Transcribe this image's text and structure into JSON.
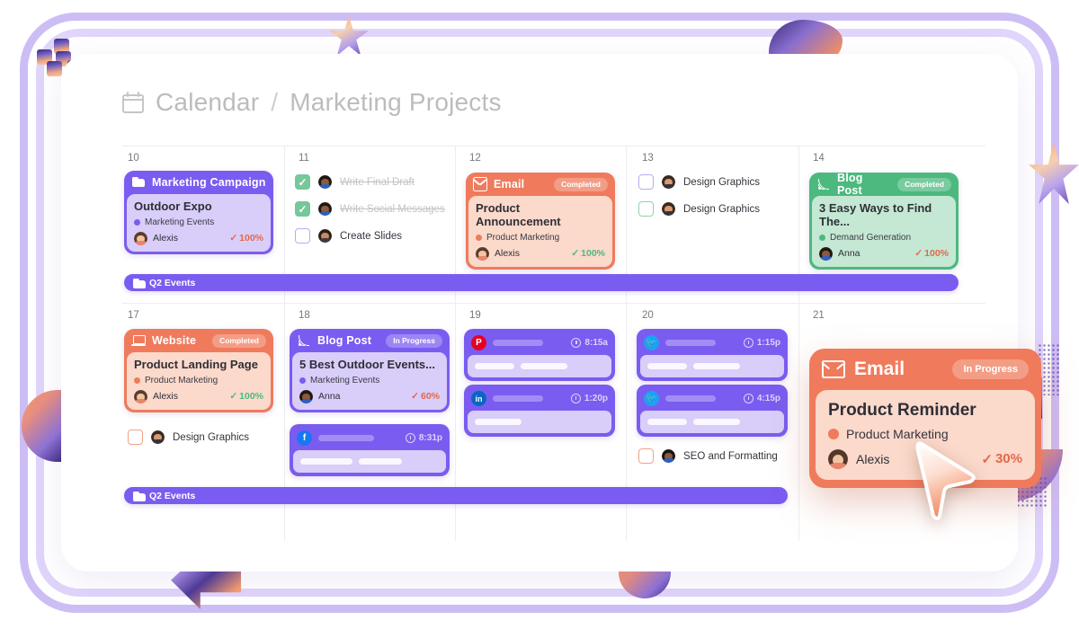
{
  "header": {
    "calendar_icon": "calendar-icon",
    "breadcrumb_root": "Calendar",
    "breadcrumb_sep": "/",
    "breadcrumb_current": "Marketing Projects"
  },
  "colors": {
    "purple": "#7b5cf0",
    "purple_light": "#d9cdf9",
    "coral": "#ef7b5c",
    "coral_light": "#fbd9cb",
    "green": "#4cb97e",
    "green_light": "#c4e8d3",
    "frame_outer": "#cdbdf5",
    "frame_inner": "#e0d5fb"
  },
  "week1": {
    "days": [
      "10",
      "11",
      "12",
      "13",
      "14"
    ],
    "cards": [
      {
        "day": "10",
        "type_label": "Marketing Campaign",
        "icon": "folder-icon",
        "badge": "",
        "title": "Outdoor Expo",
        "tag": "Marketing Events",
        "assignee": "Alexis",
        "progress": "100%",
        "theme": "purple"
      },
      {
        "day": "12",
        "type_label": "Email",
        "icon": "envelope-icon",
        "badge": "Completed",
        "title": "Product Announcement",
        "tag": "Product Marketing",
        "assignee": "Alexis",
        "progress": "100%",
        "theme": "coral"
      },
      {
        "day": "14",
        "type_label": "Blog Post",
        "icon": "rss-icon",
        "badge": "Completed",
        "title": "3 Easy Ways to Find The...",
        "tag": "Demand Generation",
        "assignee": "Anna",
        "progress": "100%",
        "theme": "green"
      }
    ],
    "tasks_day11": [
      {
        "label": "Write Final Draft",
        "checked": true,
        "assignee": "avatar-dark"
      },
      {
        "label": "Write Social Messages",
        "checked": true,
        "assignee": "avatar-dark"
      },
      {
        "label": "Create Slides",
        "checked": false,
        "assignee": "avatar-man",
        "box": "purple"
      }
    ],
    "tasks_day13": [
      {
        "label": "Design Graphics",
        "checked": false,
        "assignee": "avatar-beard",
        "box": "purple"
      },
      {
        "label": "Design Graphics",
        "checked": false,
        "assignee": "avatar-beard",
        "box": "green"
      }
    ],
    "span_bar": {
      "label": "Q2 Events",
      "icon": "folder-icon"
    }
  },
  "week2": {
    "days": [
      "17",
      "18",
      "19",
      "20",
      "21"
    ],
    "cards": [
      {
        "day": "17",
        "type_label": "Website",
        "icon": "laptop-icon",
        "badge": "Completed",
        "title": "Product Landing Page",
        "tag": "Product Marketing",
        "assignee": "Alexis",
        "progress": "100%",
        "theme": "coral"
      },
      {
        "day": "18",
        "type_label": "Blog Post",
        "icon": "rss-icon",
        "badge": "In Progress",
        "title": "5 Best Outdoor Events...",
        "tag": "Marketing Events",
        "assignee": "Anna",
        "progress": "60%",
        "theme": "purple"
      }
    ],
    "tasks_day17": [
      {
        "label": "Design Graphics",
        "checked": false,
        "assignee": "avatar-beard",
        "box": "orange"
      }
    ],
    "tasks_day20": [
      {
        "label": "SEO and Formatting",
        "checked": false,
        "assignee": "avatar-dark",
        "box": "orange"
      }
    ],
    "social": [
      {
        "day": "18",
        "network": "facebook",
        "glyph": "f",
        "time": "8:31p",
        "lines": 2
      },
      {
        "day": "19",
        "network": "pinterest",
        "glyph": "P",
        "time": "8:15a",
        "lines": 2
      },
      {
        "day": "19",
        "network": "linkedin",
        "glyph": "in",
        "time": "1:20p",
        "lines": 1
      },
      {
        "day": "20",
        "network": "twitter",
        "glyph": "t",
        "time": "1:15p",
        "lines": 2
      },
      {
        "day": "20",
        "network": "twitter",
        "glyph": "t",
        "time": "4:15p",
        "lines": 2
      }
    ],
    "span_bar": {
      "label": "Q2 Events",
      "icon": "folder-icon"
    }
  },
  "floating_card": {
    "type_label": "Email",
    "icon": "envelope-icon",
    "badge": "In Progress",
    "title": "Product Reminder",
    "tag": "Product Marketing",
    "assignee": "Alexis",
    "progress": "30%",
    "check_glyph": "✓"
  },
  "cursor": {
    "name": "mouse-pointer"
  }
}
